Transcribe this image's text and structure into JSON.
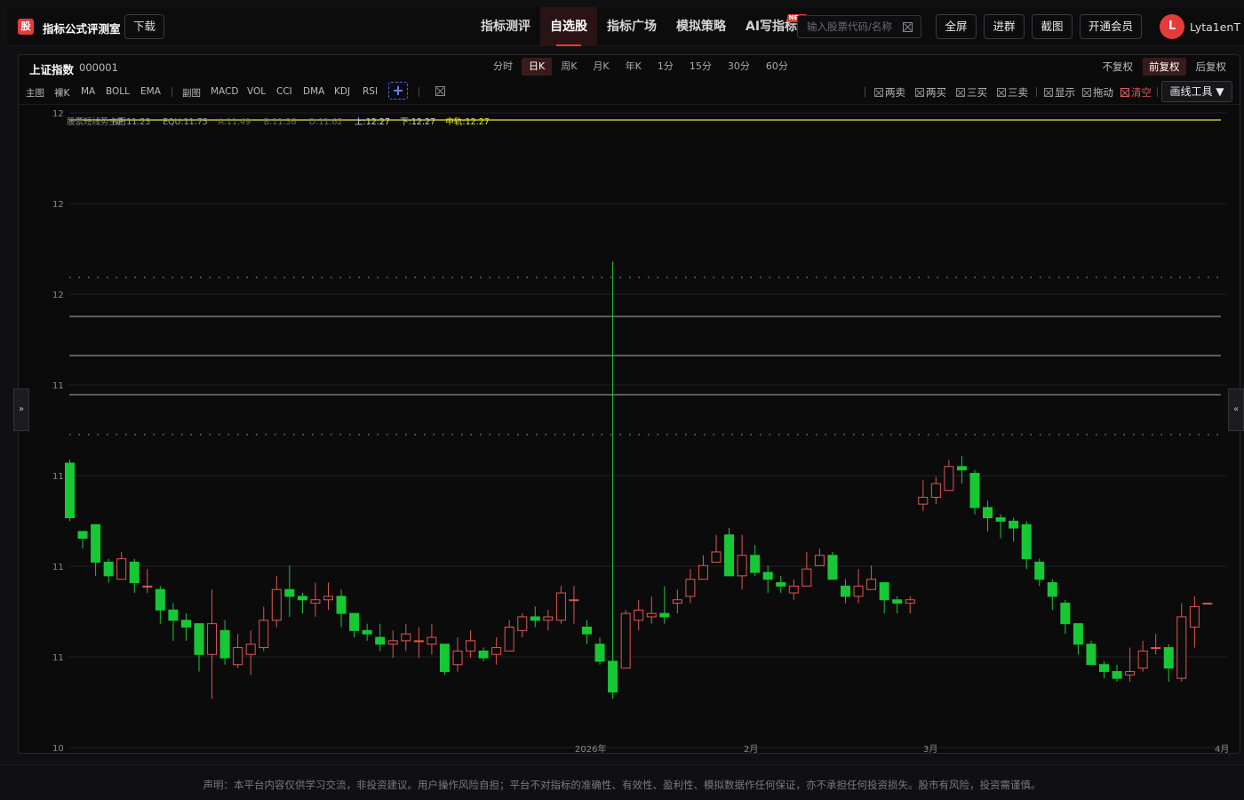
{
  "app": {
    "logo_char": "股",
    "title": "指标公式评测室",
    "download": "下载"
  },
  "nav": [
    {
      "label": "指标测评",
      "active": false
    },
    {
      "label": "自选股",
      "active": true
    },
    {
      "label": "指标广场",
      "active": false
    },
    {
      "label": "模拟策略",
      "active": false
    },
    {
      "label": "AI写指标",
      "active": false,
      "badge": "NEW"
    }
  ],
  "search": {
    "placeholder": "输入股票代码/名称",
    "value": ""
  },
  "toolbar": {
    "fullscreen": "全屏",
    "join_group": "进群",
    "screenshot": "截图",
    "vip": "开通会员"
  },
  "user": {
    "initial": "L",
    "name": "Lyta1enT"
  },
  "stock": {
    "name": "上证指数",
    "code": "000001"
  },
  "periods": [
    "分时",
    "日K",
    "周K",
    "月K",
    "年K",
    "1分",
    "15分",
    "30分",
    "60分"
  ],
  "active_period": "日K",
  "adjust": [
    "不复权",
    "前复权",
    "后复权"
  ],
  "active_adjust": "前复权",
  "indicators": {
    "main_label": "主图",
    "main": [
      "裸K",
      "MA",
      "BOLL",
      "EMA"
    ],
    "sub_label": "副图",
    "sub": [
      "MACD",
      "VOL",
      "CCI",
      "DMA",
      "KDJ",
      "RSI"
    ],
    "add": "+"
  },
  "tools": [
    {
      "label": "两卖",
      "red": false
    },
    {
      "label": "两买",
      "red": false
    },
    {
      "label": "三买",
      "red": false
    },
    {
      "label": "三卖",
      "red": false
    },
    {
      "label": "显示",
      "red": false
    },
    {
      "label": "拖动",
      "red": false
    },
    {
      "label": "清空",
      "red": true
    }
  ],
  "draw_tool": "画线工具 ▼",
  "side_tabs": {
    "left": "»",
    "right": "«"
  },
  "legend": [
    {
      "text": "股票短线势主图",
      "color": "#8a8a8a"
    },
    {
      "text": "NP:11.23",
      "color": "#a0a0a0"
    },
    {
      "text": "EQU:11.75",
      "color": "#a0a0a0"
    },
    {
      "text": "A:11.49",
      "color": "#6e6e6e"
    },
    {
      "text": "B:11.36",
      "color": "#6e6e6e"
    },
    {
      "text": "D:11.62",
      "color": "#6e6e6e"
    },
    {
      "text": "上:12.27",
      "color": "#d8d8d8"
    },
    {
      "text": "下:12.27",
      "color": "#d8d8d8"
    },
    {
      "text": "中轨:12.27",
      "color": "#e8e832"
    }
  ],
  "colors": {
    "up": "#e0574f",
    "down": "#17c835",
    "accent": "#e63b3b",
    "mid_line": "#e8e832"
  },
  "chart_data": {
    "type": "candlestick",
    "y_tick_labels": [
      "12",
      "12",
      "12",
      "11",
      "11",
      "11",
      "11",
      "10"
    ],
    "x_tick_labels": [
      "2026年",
      "2月",
      "3月",
      "4月"
    ],
    "reference_lines": {
      "mid_rail": 12.27,
      "upper_rail": 12.27,
      "lower_rail": 12.27
    },
    "candles": [
      [
        11.33,
        11.17,
        11.34,
        11.16
      ],
      [
        11.13,
        11.11,
        11.13,
        11.08
      ],
      [
        11.15,
        11.04,
        11.15,
        11.0
      ],
      [
        11.04,
        11.0,
        11.05,
        10.98
      ],
      [
        10.99,
        11.05,
        11.07,
        10.99
      ],
      [
        11.04,
        10.98,
        11.05,
        10.95
      ],
      [
        10.97,
        10.97,
        11.02,
        10.95
      ],
      [
        10.96,
        10.9,
        10.97,
        10.86
      ],
      [
        10.9,
        10.87,
        10.92,
        10.81
      ],
      [
        10.87,
        10.85,
        10.89,
        10.81
      ],
      [
        10.86,
        10.77,
        10.86,
        10.72
      ],
      [
        10.77,
        10.86,
        10.96,
        10.64
      ],
      [
        10.84,
        10.76,
        10.87,
        10.74
      ],
      [
        10.74,
        10.79,
        10.83,
        10.73
      ],
      [
        10.77,
        10.8,
        10.84,
        10.71
      ],
      [
        10.79,
        10.87,
        10.91,
        10.78
      ],
      [
        10.87,
        10.96,
        11.0,
        10.85
      ],
      [
        10.96,
        10.94,
        11.03,
        10.88
      ],
      [
        10.94,
        10.93,
        10.95,
        10.89
      ],
      [
        10.92,
        10.93,
        10.98,
        10.88
      ],
      [
        10.93,
        10.94,
        10.98,
        10.9
      ],
      [
        10.94,
        10.89,
        10.96,
        10.85
      ],
      [
        10.89,
        10.84,
        10.87,
        10.82
      ],
      [
        10.84,
        10.83,
        10.86,
        10.81
      ],
      [
        10.82,
        10.8,
        10.86,
        10.78
      ],
      [
        10.8,
        10.81,
        10.84,
        10.76
      ],
      [
        10.81,
        10.83,
        10.86,
        10.78
      ],
      [
        10.81,
        10.81,
        10.85,
        10.76
      ],
      [
        10.8,
        10.82,
        10.86,
        10.77
      ],
      [
        10.8,
        10.72,
        10.8,
        10.71
      ],
      [
        10.74,
        10.78,
        10.82,
        10.72
      ],
      [
        10.78,
        10.81,
        10.84,
        10.76
      ],
      [
        10.78,
        10.76,
        10.79,
        10.75
      ],
      [
        10.77,
        10.79,
        10.82,
        10.74
      ],
      [
        10.78,
        10.85,
        10.87,
        10.78
      ],
      [
        10.84,
        10.88,
        10.89,
        10.82
      ],
      [
        10.88,
        10.87,
        10.91,
        10.85
      ],
      [
        10.87,
        10.88,
        10.9,
        10.84
      ],
      [
        10.87,
        10.95,
        10.97,
        10.86
      ],
      [
        10.93,
        10.93,
        10.97,
        10.86
      ],
      [
        10.85,
        10.83,
        10.87,
        10.8
      ],
      [
        10.8,
        10.75,
        10.82,
        10.74
      ],
      [
        10.75,
        10.66,
        11.92,
        10.64
      ],
      [
        10.73,
        10.89,
        10.9,
        10.73
      ],
      [
        10.87,
        10.9,
        10.93,
        10.84
      ],
      [
        10.88,
        10.89,
        10.94,
        10.86
      ],
      [
        10.89,
        10.88,
        10.97,
        10.86
      ],
      [
        10.92,
        10.93,
        10.96,
        10.89
      ],
      [
        10.94,
        10.99,
        11.02,
        10.92
      ],
      [
        10.99,
        11.03,
        11.06,
        10.99
      ],
      [
        11.04,
        11.07,
        11.12,
        11.04
      ],
      [
        11.12,
        11.0,
        11.14,
        11.0
      ],
      [
        11.0,
        11.06,
        11.12,
        10.96
      ],
      [
        11.06,
        11.01,
        11.09,
        11.0
      ],
      [
        11.01,
        10.99,
        11.03,
        10.95
      ],
      [
        10.98,
        10.97,
        11.0,
        10.95
      ],
      [
        10.95,
        10.97,
        10.99,
        10.93
      ],
      [
        10.97,
        11.02,
        11.07,
        10.97
      ],
      [
        11.03,
        11.06,
        11.08,
        11.03
      ],
      [
        11.06,
        10.99,
        11.07,
        10.99
      ],
      [
        10.97,
        10.94,
        10.99,
        10.92
      ],
      [
        10.94,
        10.97,
        11.02,
        10.92
      ],
      [
        10.96,
        10.99,
        11.03,
        10.96
      ],
      [
        10.98,
        10.93,
        10.98,
        10.89
      ],
      [
        10.93,
        10.92,
        10.94,
        10.89
      ],
      [
        10.92,
        10.93,
        10.94,
        10.89
      ],
      [
        11.21,
        11.23,
        11.28,
        11.19
      ],
      [
        11.23,
        11.27,
        11.29,
        11.21
      ],
      [
        11.25,
        11.32,
        11.34,
        11.26
      ],
      [
        11.32,
        11.31,
        11.35,
        11.27
      ],
      [
        11.3,
        11.2,
        11.31,
        11.18
      ],
      [
        11.2,
        11.17,
        11.22,
        11.13
      ],
      [
        11.17,
        11.16,
        11.18,
        11.11
      ],
      [
        11.16,
        11.14,
        11.17,
        11.1
      ],
      [
        11.15,
        11.05,
        11.16,
        11.02
      ],
      [
        11.04,
        10.99,
        11.05,
        10.97
      ],
      [
        10.98,
        10.94,
        10.99,
        10.9
      ],
      [
        10.92,
        10.86,
        10.93,
        10.83
      ],
      [
        10.86,
        10.8,
        10.86,
        10.77
      ],
      [
        10.8,
        10.74,
        10.81,
        10.74
      ],
      [
        10.74,
        10.72,
        10.75,
        10.7
      ],
      [
        10.72,
        10.7,
        10.74,
        10.69
      ],
      [
        10.71,
        10.72,
        10.79,
        10.69
      ],
      [
        10.73,
        10.78,
        10.81,
        10.72
      ],
      [
        10.79,
        10.79,
        10.83,
        10.77
      ],
      [
        10.79,
        10.73,
        10.8,
        10.69
      ],
      [
        10.7,
        10.88,
        10.92,
        10.69
      ],
      [
        10.85,
        10.91,
        10.94,
        10.79
      ],
      [
        10.92,
        10.92,
        10.92,
        10.92
      ]
    ]
  }
}
